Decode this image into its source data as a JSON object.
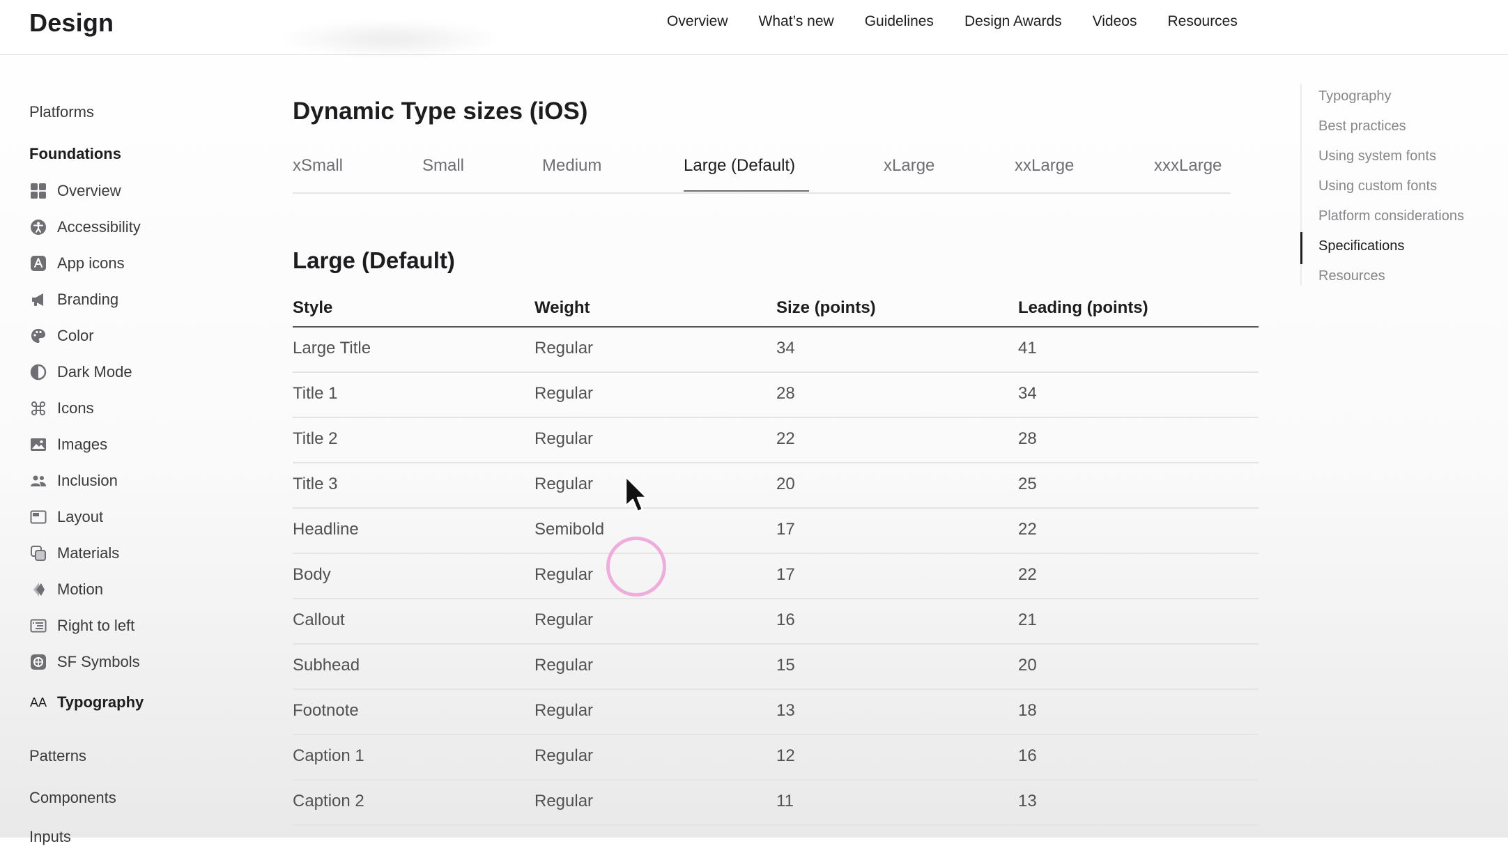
{
  "brand": "Design",
  "topnav": [
    "Overview",
    "What’s new",
    "Guidelines",
    "Design Awards",
    "Videos",
    "Resources"
  ],
  "sidebar": {
    "platforms": "Platforms",
    "foundations": "Foundations",
    "items": [
      {
        "label": "Overview",
        "icon": "overview-grid-icon"
      },
      {
        "label": "Accessibility",
        "icon": "accessibility-icon"
      },
      {
        "label": "App icons",
        "icon": "app-icons-icon"
      },
      {
        "label": "Branding",
        "icon": "megaphone-icon"
      },
      {
        "label": "Color",
        "icon": "palette-icon"
      },
      {
        "label": "Dark Mode",
        "icon": "dark-mode-icon"
      },
      {
        "label": "Icons",
        "icon": "command-icon"
      },
      {
        "label": "Images",
        "icon": "photo-icon"
      },
      {
        "label": "Inclusion",
        "icon": "people-icon"
      },
      {
        "label": "Layout",
        "icon": "layout-icon"
      },
      {
        "label": "Materials",
        "icon": "materials-icon"
      },
      {
        "label": "Motion",
        "icon": "motion-icon"
      },
      {
        "label": "Right to left",
        "icon": "right-to-left-icon"
      },
      {
        "label": "SF Symbols",
        "icon": "sf-symbols-icon"
      }
    ],
    "active_prefix": "AA",
    "active_item": "Typography",
    "patterns": "Patterns",
    "components": "Components",
    "inputs": "Inputs"
  },
  "main": {
    "dynamic_title": "Dynamic Type sizes (iOS)",
    "tabs": [
      "xSmall",
      "Small",
      "Medium",
      "Large (Default)",
      "xLarge",
      "xxLarge",
      "xxxLarge"
    ],
    "active_tab": "Large (Default)",
    "section_title": "Large (Default)",
    "columns": [
      "Style",
      "Weight",
      "Size (points)",
      "Leading (points)"
    ],
    "rows": [
      [
        "Large Title",
        "Regular",
        "34",
        "41"
      ],
      [
        "Title 1",
        "Regular",
        "28",
        "34"
      ],
      [
        "Title 2",
        "Regular",
        "22",
        "28"
      ],
      [
        "Title 3",
        "Regular",
        "20",
        "25"
      ],
      [
        "Headline",
        "Semibold",
        "17",
        "22"
      ],
      [
        "Body",
        "Regular",
        "17",
        "22"
      ],
      [
        "Callout",
        "Regular",
        "16",
        "21"
      ],
      [
        "Subhead",
        "Regular",
        "15",
        "20"
      ],
      [
        "Footnote",
        "Regular",
        "13",
        "18"
      ],
      [
        "Caption 1",
        "Regular",
        "12",
        "16"
      ],
      [
        "Caption 2",
        "Regular",
        "11",
        "13"
      ]
    ]
  },
  "toc": {
    "items": [
      "Typography",
      "Best practices",
      "Using system fonts",
      "Using custom fonts",
      "Platform considerations",
      "Specifications",
      "Resources"
    ],
    "active": "Specifications"
  },
  "colors": {
    "text": "#1d1d1f",
    "muted": "#6e6e73",
    "click_ring": "#eca0d6"
  }
}
